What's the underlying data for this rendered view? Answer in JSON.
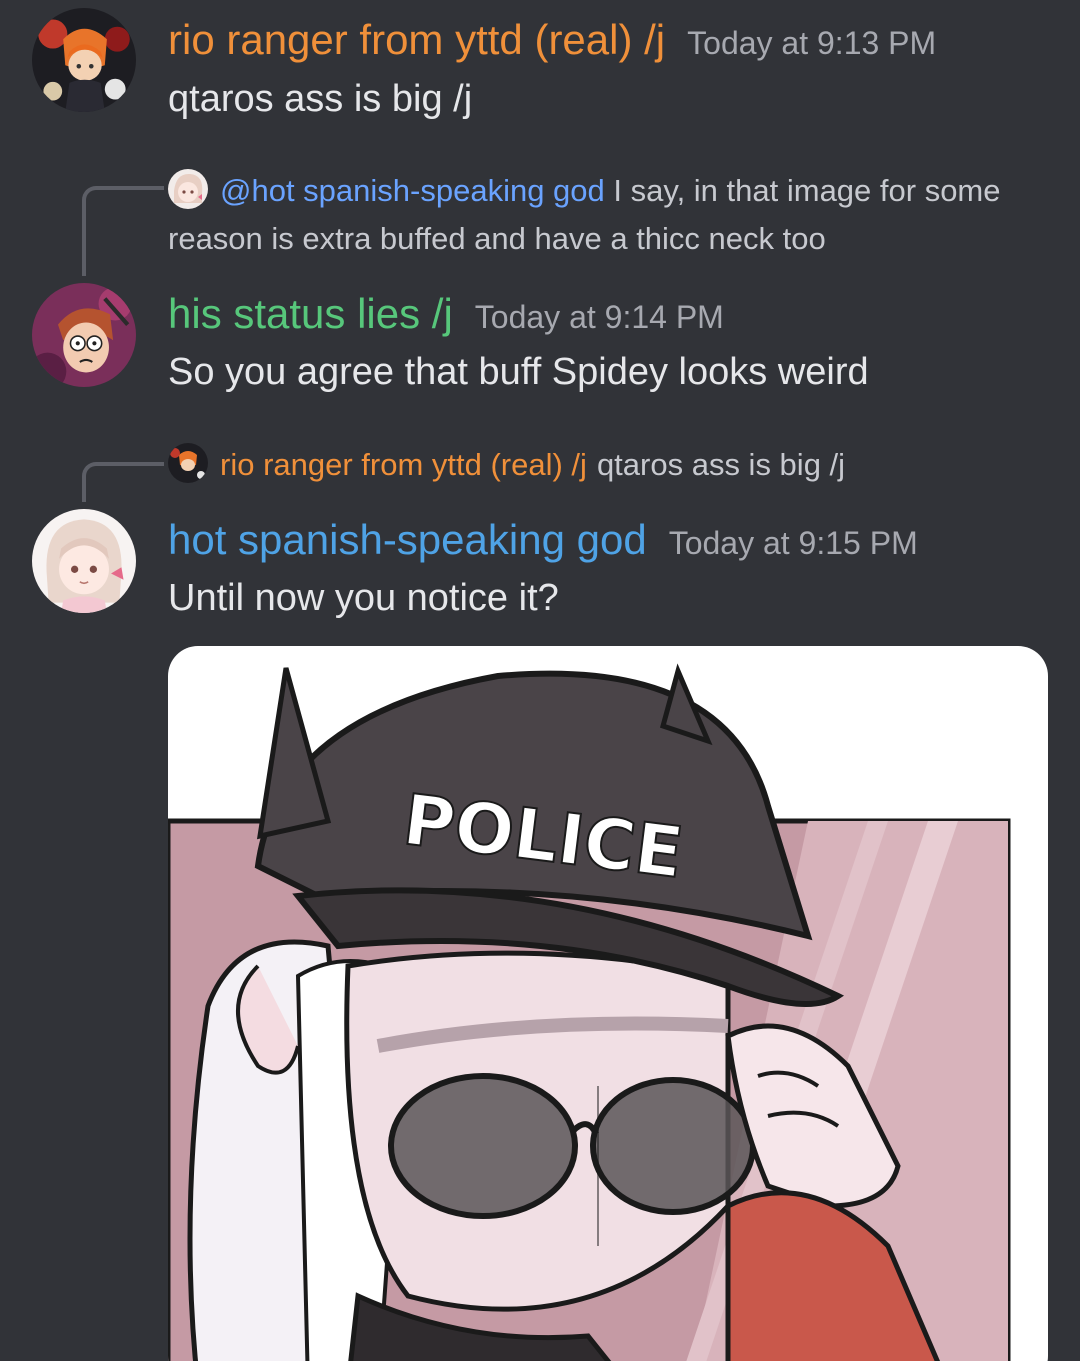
{
  "messages": [
    {
      "author": "rio ranger from yttd (real) /j",
      "author_color": "#f0903a",
      "timestamp": "Today at 9:13 PM",
      "text": "qtaros ass is big /j"
    },
    {
      "reply_to": {
        "mention": "@hot spanish-speaking god",
        "preview_line1": "I say, in that image for some",
        "preview_line2": "reason is extra buffed and have a thicc neck too"
      },
      "author": "his status lies /j",
      "author_color": "#57c77b",
      "timestamp": "Today at 9:14 PM",
      "text": "So you agree that buff Spidey looks weird"
    },
    {
      "reply_to": {
        "author": "rio ranger from yttd (real) /j",
        "preview": "qtaros ass is big /j"
      },
      "author": "hot spanish-speaking god",
      "author_color": "#4fa3e6",
      "timestamp": "Today at 9:15 PM",
      "text": "Until now you notice it?",
      "attachment": {
        "type": "image",
        "visible_text": "POLICE"
      }
    }
  ]
}
